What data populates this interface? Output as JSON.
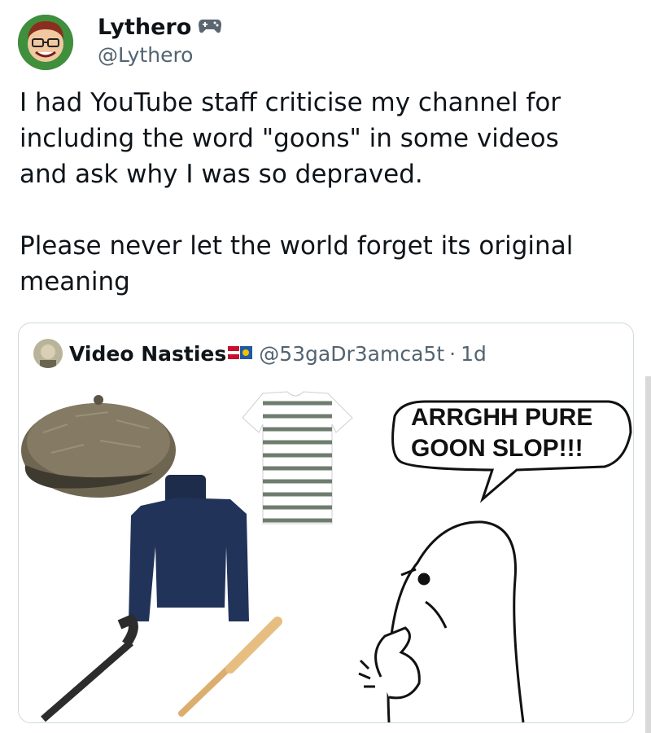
{
  "author": {
    "name": "Lythero",
    "badge_icon": "gamepad-icon",
    "handle": "@Lythero"
  },
  "tweet": {
    "paragraph1": "I had YouTube staff criticise my channel for\nincluding the word \"goons\" in some videos\nand ask why I was so depraved.",
    "paragraph2": "Please never let the world forget its original\nmeaning"
  },
  "quoted": {
    "name": "Video Nasties",
    "flag_icon": "flag-emoji-icons",
    "handle": "@53gaDr3amca5t",
    "separator": "·",
    "time": "1d",
    "meme": {
      "speech_bubble": "ARRGHH PURE\nGOON SLOP!!!",
      "items": [
        "flat-cap",
        "striped-t-shirt",
        "navy-turtleneck-sweater",
        "iron-pipe",
        "baseball-bat",
        "character-thinking"
      ]
    }
  }
}
